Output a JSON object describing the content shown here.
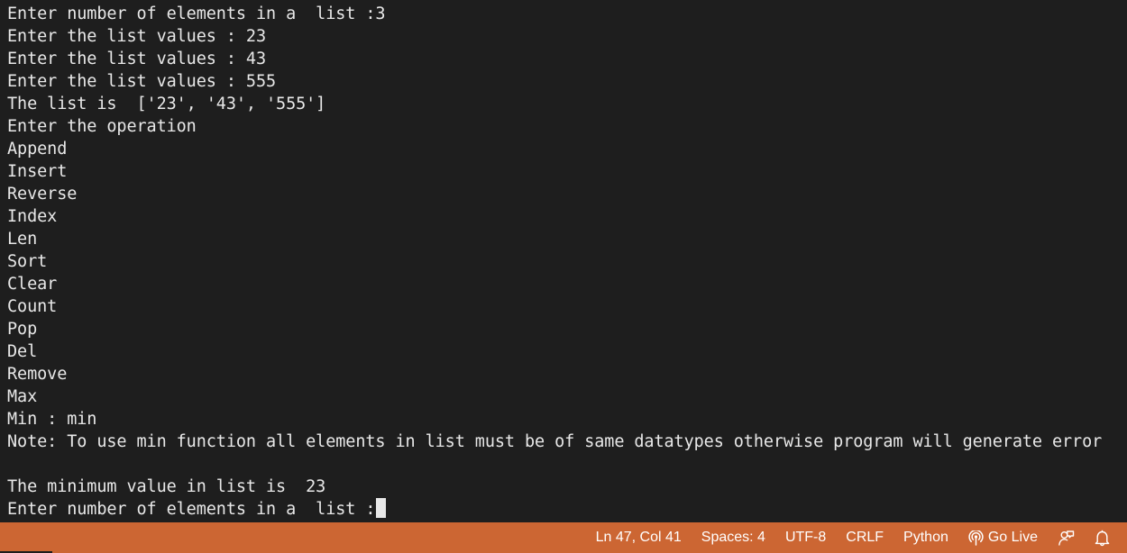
{
  "terminal": {
    "lines": [
      "Enter number of elements in a  list :3",
      "Enter the list values : 23",
      "Enter the list values : 43",
      "Enter the list values : 555",
      "The list is  ['23', '43', '555']",
      "Enter the operation",
      "Append",
      "Insert",
      "Reverse",
      "Index",
      "Len",
      "Sort",
      "Clear",
      "Count",
      "Pop",
      "Del",
      "Remove",
      "Max",
      "Min : min",
      "Note: To use min function all elements in list must be of same datatypes otherwise program will generate error",
      "",
      "The minimum value in list is  23",
      "Enter number of elements in a  list :"
    ]
  },
  "status_bar": {
    "background_color": "#cc6633",
    "cursor_position": "Ln 47, Col 41",
    "indentation": "Spaces: 4",
    "encoding": "UTF-8",
    "line_ending": "CRLF",
    "language": "Python",
    "go_live": "Go Live",
    "feedback_icon": "feedback-icon",
    "notifications_icon": "bell-icon"
  }
}
